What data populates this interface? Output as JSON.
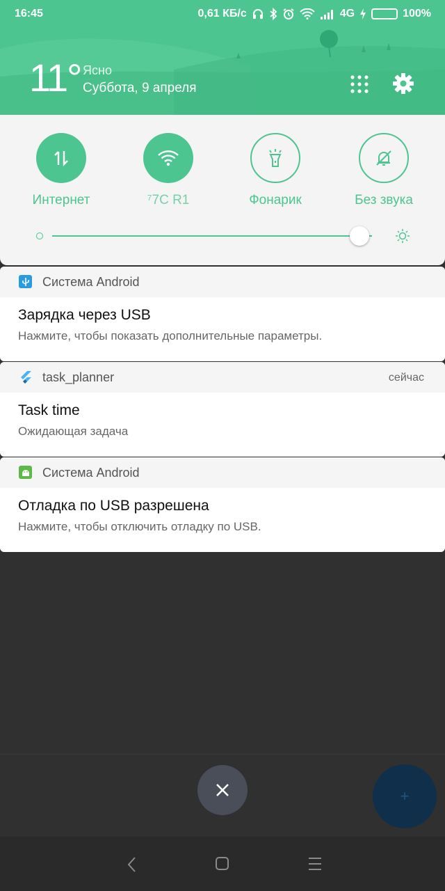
{
  "status_bar": {
    "time": "16:45",
    "speed": "0,61 КБ/с",
    "network": "4G",
    "battery": "100%",
    "battery_level": 1.0
  },
  "header": {
    "temperature": "11°",
    "weather": "Ясно",
    "date": "Суббота, 9 апреля"
  },
  "quick_settings": {
    "tiles": [
      {
        "label": "Интернет",
        "state": "on",
        "icon": "data-arrows-icon"
      },
      {
        "label": "⁷7C   R1",
        "state": "on",
        "icon": "wifi-icon"
      },
      {
        "label": "Фонарик",
        "state": "off",
        "icon": "flashlight-icon"
      },
      {
        "label": "Без звука",
        "state": "off",
        "icon": "bell-off-icon"
      }
    ],
    "brightness_level": 0.96
  },
  "notifications": [
    {
      "app": "Система Android",
      "title": "Зарядка через USB",
      "text": "Нажмите, чтобы показать дополнительные параметры.",
      "time": "",
      "icon": "usb-icon"
    },
    {
      "app": "task_planner",
      "title": "Task time",
      "text": "Ожидающая задача",
      "time": "сейчас",
      "icon": "flutter-icon"
    },
    {
      "app": "Система Android",
      "title": "Отладка по USB разрешена",
      "text": "Нажмите, чтобы отключить отладку по USB.",
      "time": "",
      "icon": "android-icon"
    }
  ],
  "fab_label": "+",
  "colors": {
    "accent": "#4dc591",
    "background": "#303030"
  }
}
